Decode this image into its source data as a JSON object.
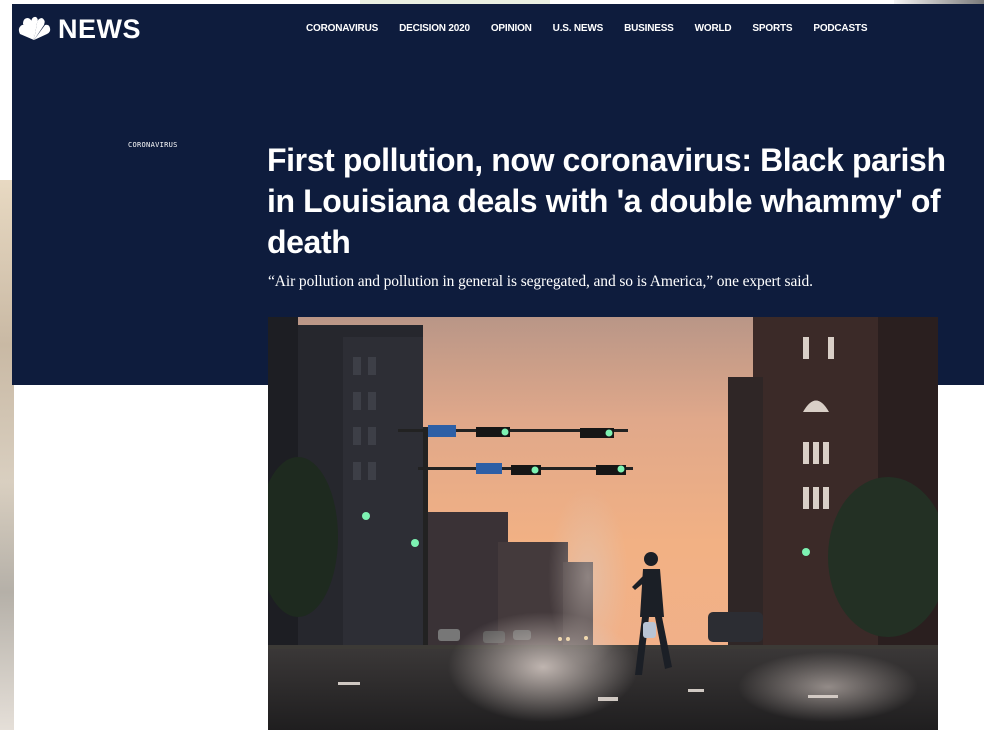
{
  "brand": {
    "logo_text": "NEWS",
    "logo_icon": "peacock-icon"
  },
  "nav": {
    "items": [
      {
        "label": "CORONAVIRUS"
      },
      {
        "label": "DECISION 2020"
      },
      {
        "label": "OPINION"
      },
      {
        "label": "U.S. NEWS"
      },
      {
        "label": "BUSINESS"
      },
      {
        "label": "WORLD"
      },
      {
        "label": "SPORTS"
      },
      {
        "label": "PODCASTS"
      }
    ]
  },
  "article": {
    "section": "CORONAVIRUS",
    "headline": "First pollution, now coronavirus: Black parish in Louisiana deals with 'a double whammy' of death",
    "dek": "“Air pollution and pollution in general is segregated, and so is America,” one expert said."
  },
  "colors": {
    "header_background": "#0e1c3d",
    "text": "#ffffff"
  }
}
